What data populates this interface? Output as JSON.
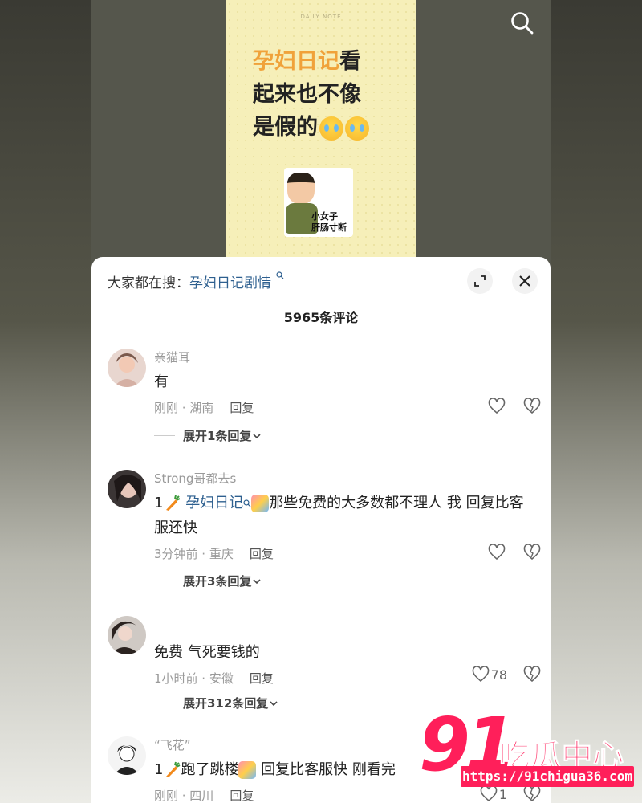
{
  "video": {
    "daily_note": "DAILY NOTE",
    "title_highlight": "孕妇日记",
    "title_rest": "看\n起来也不像\n是假的",
    "sticker_text": "小女子\n肝肠寸断"
  },
  "sheet": {
    "search_prefix": "大家都在搜：",
    "search_keyword": "孕妇日记剧情",
    "comment_count": "5965条评论"
  },
  "comments": [
    {
      "user": "亲猫耳",
      "text": "有",
      "time_location": "刚刚 · 湖南",
      "reply_label": "回复",
      "likes": "",
      "expand_label": "展开1条回复"
    },
    {
      "user": "Strong哥都去s",
      "text_prefix": "1",
      "text_keyword": "孕妇日记",
      "text_rest": "那些免费的大多数都不理人 我 回复比客服还快",
      "time_location": "3分钟前 · 重庆",
      "reply_label": "回复",
      "likes": "",
      "expand_label": "展开3条回复"
    },
    {
      "user": "",
      "text": "免费 气死要钱的",
      "time_location": "1小时前 · 安徽",
      "reply_label": "回复",
      "likes": "78",
      "expand_label": "展开312条回复"
    },
    {
      "user": "“飞花”",
      "text_prefix": "1",
      "text_mid": "跑了跳楼",
      "text_rest": " 回复比客服快 刚看完",
      "time_location": "刚刚 · 四川",
      "reply_label": "回复",
      "likes": "1"
    }
  ],
  "watermark": {
    "number": "91",
    "name": "吃瓜中心",
    "url": "https://91chigua36.com"
  },
  "icons": {
    "search": "search-icon",
    "expand": "expand-icon",
    "close": "close-icon",
    "like": "heart-outline-icon",
    "dislike": "broken-heart-icon",
    "chevron": "chevron-down-icon"
  },
  "colors": {
    "keyword": "#2d5f8f",
    "title_highlight": "#f0a23a",
    "watermark": "#ff1f5a"
  }
}
